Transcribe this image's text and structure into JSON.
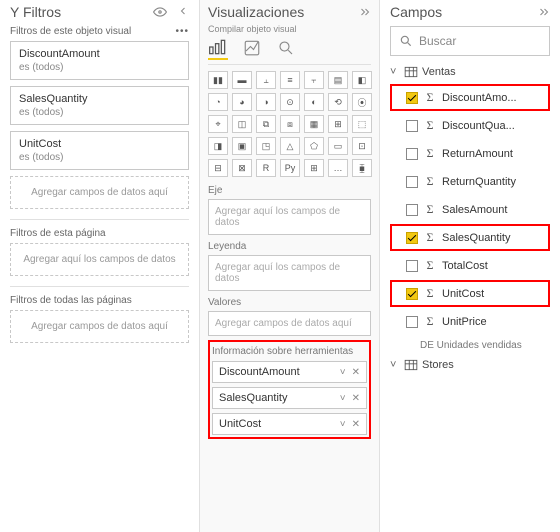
{
  "filters": {
    "title": "Y Filtros",
    "visual_section": "Filtros de este objeto visual",
    "cards": [
      {
        "name": "DiscountAmount",
        "state": "es (todos)"
      },
      {
        "name": "SalesQuantity",
        "state": "es (todos)"
      },
      {
        "name": "UnitCost",
        "state": "es (todos)"
      }
    ],
    "add_visual": "Agregar campos de datos aquí",
    "page_section": "Filtros de esta página",
    "add_page": "Agregar aquí los campos de datos",
    "all_section": "Filtros de todas las páginas",
    "add_all": "Agregar campos de datos aquí"
  },
  "viz": {
    "title": "Visualizaciones",
    "subtitle": "Compilar objeto visual",
    "axis_label": "Eje",
    "axis_placeholder": "Agregar aquí los campos de datos",
    "legend_label": "Leyenda",
    "legend_placeholder": "Agregar aquí los campos de datos",
    "values_label": "Valores",
    "values_placeholder": "Agregar campos de datos aquí",
    "tooltip_label": "Información sobre herramientas",
    "tooltip_items": [
      "DiscountAmount",
      "SalesQuantity",
      "UnitCost"
    ]
  },
  "fields": {
    "title": "Campos",
    "search_placeholder": "Buscar",
    "tables": [
      {
        "name": "Ventas",
        "expanded": true,
        "fields": [
          {
            "name": "DiscountAmo...",
            "checked": true,
            "hl": true
          },
          {
            "name": "DiscountQua...",
            "checked": false,
            "hl": false
          },
          {
            "name": "ReturnAmount",
            "checked": false,
            "hl": false
          },
          {
            "name": "ReturnQuantity",
            "checked": false,
            "hl": false
          },
          {
            "name": "SalesAmount",
            "checked": false,
            "hl": false
          },
          {
            "name": "SalesQuantity",
            "checked": true,
            "hl": true
          },
          {
            "name": "TotalCost",
            "checked": false,
            "hl": false
          },
          {
            "name": "UnitCost",
            "checked": true,
            "hl": true
          },
          {
            "name": "UnitPrice",
            "checked": false,
            "hl": false
          }
        ],
        "calc": "DE Unidades vendidas"
      },
      {
        "name": "Stores",
        "expanded": false
      }
    ]
  }
}
